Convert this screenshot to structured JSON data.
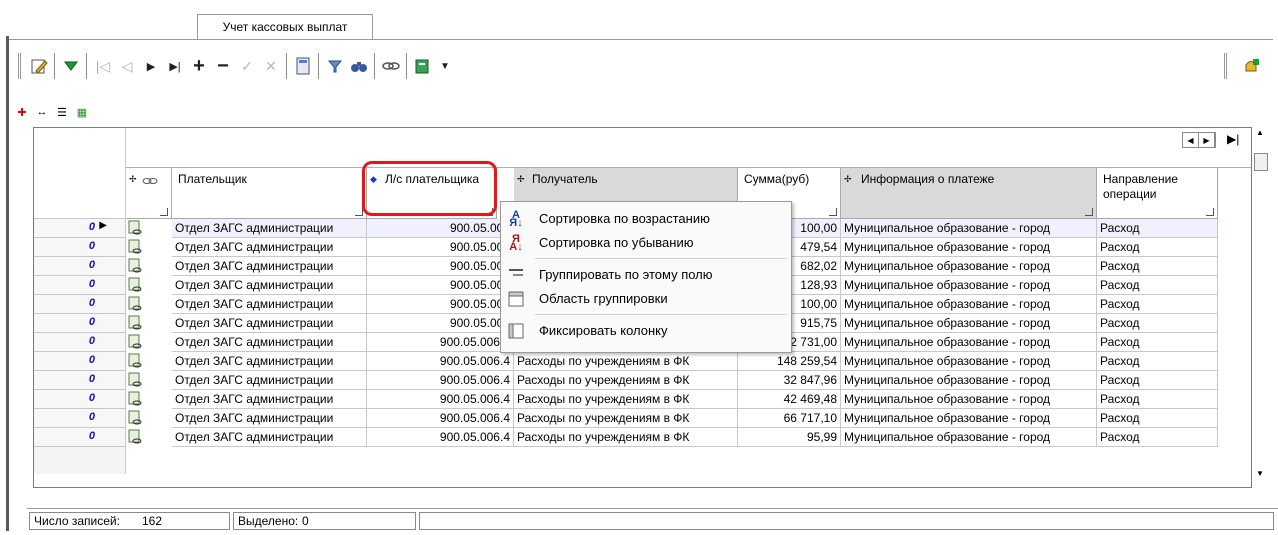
{
  "tab": {
    "label": "Учет кассовых выплат"
  },
  "toolbar": {
    "icons": [
      "edit-icon",
      "filter-down-icon",
      "first-record-icon",
      "prev-record-icon",
      "next-record-icon",
      "last-record-icon",
      "add-icon",
      "delete-icon",
      "confirm-icon",
      "cancel-icon",
      "calculator-icon",
      "filter-icon",
      "search-icon",
      "link-icon",
      "export-icon",
      "dropdown-arrow-icon",
      "notify-icon"
    ]
  },
  "grid": {
    "columns": [
      {
        "key": "payer",
        "label": "Плательщик"
      },
      {
        "key": "payer_account",
        "label": "Л/с плательщика"
      },
      {
        "key": "recipient",
        "label": "Получатель"
      },
      {
        "key": "amount",
        "label": "Сумма(руб)"
      },
      {
        "key": "payment_info",
        "label": "Информация о платеже"
      },
      {
        "key": "direction",
        "label": "Направление операции"
      }
    ],
    "rows": [
      {
        "indicator": "0",
        "payer": "Отдел ЗАГС администрации",
        "payer_account": "900.05.006",
        "recipient": "",
        "amount": "100,00",
        "payment_info": "Муниципальное образование - город",
        "direction": "Расход"
      },
      {
        "indicator": "0",
        "payer": "Отдел ЗАГС администрации",
        "payer_account": "900.05.006",
        "recipient": "",
        "amount": "479,54",
        "payment_info": "Муниципальное образование - город",
        "direction": "Расход"
      },
      {
        "indicator": "0",
        "payer": "Отдел ЗАГС администрации",
        "payer_account": "900.05.006",
        "recipient": "",
        "amount": "682,02",
        "payment_info": "Муниципальное образование - город",
        "direction": "Расход"
      },
      {
        "indicator": "0",
        "payer": "Отдел ЗАГС администрации",
        "payer_account": "900.05.006",
        "recipient": "",
        "amount": "128,93",
        "payment_info": "Муниципальное образование - город",
        "direction": "Расход"
      },
      {
        "indicator": "0",
        "payer": "Отдел ЗАГС администрации",
        "payer_account": "900.05.006",
        "recipient": "",
        "amount": "100,00",
        "payment_info": "Муниципальное образование - город",
        "direction": "Расход"
      },
      {
        "indicator": "0",
        "payer": "Отдел ЗАГС администрации",
        "payer_account": "900.05.006",
        "recipient": "",
        "amount": "915,75",
        "payment_info": "Муниципальное образование - город",
        "direction": "Расход"
      },
      {
        "indicator": "0",
        "payer": "Отдел ЗАГС администрации",
        "payer_account": "900.05.006.4",
        "recipient": "Расходы по учреждениям в ФК",
        "amount": "52 731,00",
        "payment_info": "Муниципальное образование - город",
        "direction": "Расход"
      },
      {
        "indicator": "0",
        "payer": "Отдел ЗАГС администрации",
        "payer_account": "900.05.006.4",
        "recipient": "Расходы по учреждениям в ФК",
        "amount": "148 259,54",
        "payment_info": "Муниципальное образование - город",
        "direction": "Расход"
      },
      {
        "indicator": "0",
        "payer": "Отдел ЗАГС администрации",
        "payer_account": "900.05.006.4",
        "recipient": "Расходы по учреждениям в ФК",
        "amount": "32 847,96",
        "payment_info": "Муниципальное образование - город",
        "direction": "Расход"
      },
      {
        "indicator": "0",
        "payer": "Отдел ЗАГС администрации",
        "payer_account": "900.05.006.4",
        "recipient": "Расходы по учреждениям в ФК",
        "amount": "42 469,48",
        "payment_info": "Муниципальное образование - город",
        "direction": "Расход"
      },
      {
        "indicator": "0",
        "payer": "Отдел ЗАГС администрации",
        "payer_account": "900.05.006.4",
        "recipient": "Расходы по учреждениям в ФК",
        "amount": "66 717,10",
        "payment_info": "Муниципальное образование - город",
        "direction": "Расход"
      },
      {
        "indicator": "0",
        "payer": "Отдел ЗАГС администрации",
        "payer_account": "900.05.006.4",
        "recipient": "Расходы по учреждениям в ФК",
        "amount": "95,99",
        "payment_info": "Муниципальное образование - город",
        "direction": "Расход"
      }
    ]
  },
  "context_menu": {
    "items": [
      {
        "label": "Сортировка по возрастанию",
        "icon": "sort-ascending-icon"
      },
      {
        "label": "Сортировка по убыванию",
        "icon": "sort-descending-icon"
      },
      {
        "label": "Группировать по этому полю",
        "icon": "group-by-field-icon"
      },
      {
        "label": "Область группировки",
        "icon": "grouping-area-icon"
      },
      {
        "label": "Фиксировать колонку",
        "icon": "pin-column-icon"
      }
    ]
  },
  "status": {
    "records_label": "Число записей:",
    "records_value": "162",
    "selected_label": "Выделено:",
    "selected_value": "0"
  },
  "colors": {
    "highlight": "#e01a1a",
    "indicator_text": "#1010c0"
  }
}
